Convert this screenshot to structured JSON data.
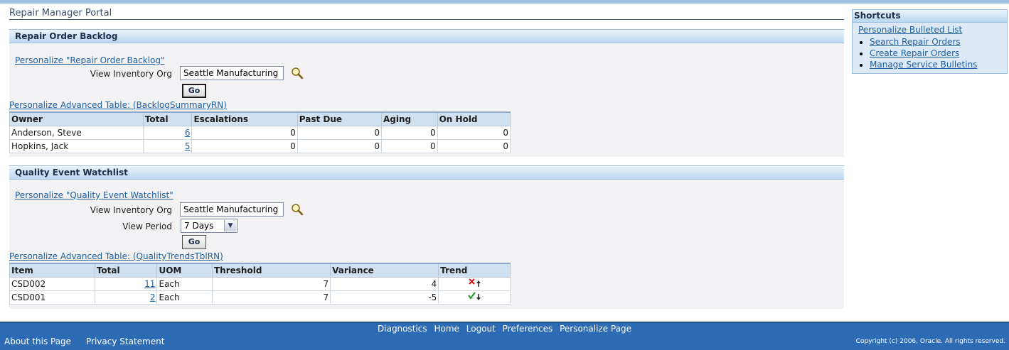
{
  "page": {
    "title": "Repair Manager Portal"
  },
  "colors": {
    "header_blue": "#2d6cb5",
    "link_blue": "#1f5e9e",
    "region_bg": "#f2f2f5",
    "table_header": "#cfe0f1"
  },
  "backlog": {
    "header": "Repair Order Backlog",
    "personalize_link": "Personalize \"Repair Order Backlog\"",
    "inventory_label": "View Inventory Org",
    "inventory_value": "Seattle Manufacturing",
    "go_label": "Go",
    "table_personalize": "Personalize Advanced Table: (BacklogSummaryRN)",
    "columns": [
      "Owner",
      "Total",
      "Escalations",
      "Past Due",
      "Aging",
      "On Hold"
    ],
    "rows": [
      {
        "owner": "Anderson, Steve",
        "total": "6",
        "escalations": "0",
        "past_due": "0",
        "aging": "0",
        "on_hold": "0"
      },
      {
        "owner": "Hopkins, Jack",
        "total": "5",
        "escalations": "0",
        "past_due": "0",
        "aging": "0",
        "on_hold": "0"
      }
    ]
  },
  "quality": {
    "header": "Quality Event Watchlist",
    "personalize_link": "Personalize \"Quality Event Watchlist\"",
    "inventory_label": "View Inventory Org",
    "inventory_value": "Seattle Manufacturing",
    "period_label": "View Period",
    "period_value": "7 Days",
    "go_label": "Go",
    "table_personalize": "Personalize Advanced Table: (QualityTrendsTblRN)",
    "columns": [
      "Item",
      "Total",
      "UOM",
      "Threshold",
      "Variance",
      "Trend"
    ],
    "rows": [
      {
        "item": "CSD002",
        "total": "11",
        "uom": "Each",
        "threshold": "7",
        "variance": "4",
        "trend": "trend-up-bad-icon"
      },
      {
        "item": "CSD001",
        "total": "2",
        "uom": "Each",
        "threshold": "7",
        "variance": "-5",
        "trend": "trend-down-good-icon"
      }
    ]
  },
  "shortcuts": {
    "header": "Shortcuts",
    "personalize_link": "Personalize Bulleted List",
    "items": [
      "Search Repair Orders",
      "Create Repair Orders",
      "Manage Service Bulletins"
    ]
  },
  "footer": {
    "links": [
      "Diagnostics",
      "Home",
      "Logout",
      "Preferences",
      "Personalize Page"
    ],
    "about": "About this Page",
    "privacy": "Privacy Statement",
    "copyright": "Copyright (c) 2006, Oracle. All rights reserved."
  }
}
